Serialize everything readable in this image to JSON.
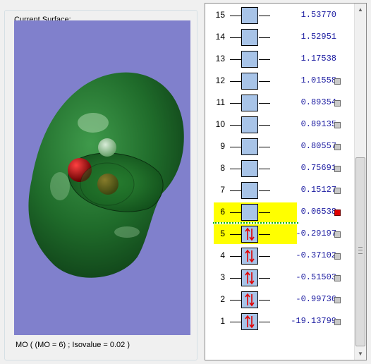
{
  "surface_panel": {
    "legend": "Current Surface:",
    "caption": "MO ( (MO = 6) ; Isovalue = 0.02 )",
    "colors": {
      "background": "#8080cc",
      "isosurface": "#1f6b2a"
    }
  },
  "orbital_levels": [
    {
      "index": "15",
      "energy": "1.53770",
      "occupied": false,
      "show_checkbox": false,
      "checked": false,
      "highlighted": false
    },
    {
      "index": "14",
      "energy": "1.52951",
      "occupied": false,
      "show_checkbox": false,
      "checked": false,
      "highlighted": false
    },
    {
      "index": "13",
      "energy": "1.17538",
      "occupied": false,
      "show_checkbox": false,
      "checked": false,
      "highlighted": false
    },
    {
      "index": "12",
      "energy": "1.01558",
      "occupied": false,
      "show_checkbox": true,
      "checked": false,
      "highlighted": false
    },
    {
      "index": "11",
      "energy": "0.89354",
      "occupied": false,
      "show_checkbox": true,
      "checked": false,
      "highlighted": false
    },
    {
      "index": "10",
      "energy": "0.89135",
      "occupied": false,
      "show_checkbox": true,
      "checked": false,
      "highlighted": false
    },
    {
      "index": "9",
      "energy": "0.80557",
      "occupied": false,
      "show_checkbox": true,
      "checked": false,
      "highlighted": false
    },
    {
      "index": "8",
      "energy": "0.75691",
      "occupied": false,
      "show_checkbox": true,
      "checked": false,
      "highlighted": false
    },
    {
      "index": "7",
      "energy": "0.15127",
      "occupied": false,
      "show_checkbox": true,
      "checked": false,
      "highlighted": false
    },
    {
      "index": "6",
      "energy": "0.06538",
      "occupied": false,
      "show_checkbox": true,
      "checked": true,
      "highlighted": true
    },
    {
      "index": "5",
      "energy": "-0.29197",
      "occupied": true,
      "show_checkbox": true,
      "checked": false,
      "highlighted": true
    },
    {
      "index": "4",
      "energy": "-0.37102",
      "occupied": true,
      "show_checkbox": true,
      "checked": false,
      "highlighted": false
    },
    {
      "index": "3",
      "energy": "-0.51503",
      "occupied": true,
      "show_checkbox": true,
      "checked": false,
      "highlighted": false
    },
    {
      "index": "2",
      "energy": "-0.99736",
      "occupied": true,
      "show_checkbox": true,
      "checked": false,
      "highlighted": false
    },
    {
      "index": "1",
      "energy": "-19.13799",
      "occupied": true,
      "show_checkbox": true,
      "checked": false,
      "highlighted": false
    }
  ],
  "colors": {
    "highlight": "#ffff00",
    "level_box": "#a8c4e8",
    "energy_text": "#1a1aa0",
    "electron_arrows": "#e00000",
    "selected_checkbox": "#e00000",
    "gap_line": "#00b000"
  },
  "icons": {
    "electron_pair": "spin-up-down-arrows-icon",
    "scroll_up": "up-arrow-icon",
    "scroll_down": "down-arrow-icon"
  }
}
